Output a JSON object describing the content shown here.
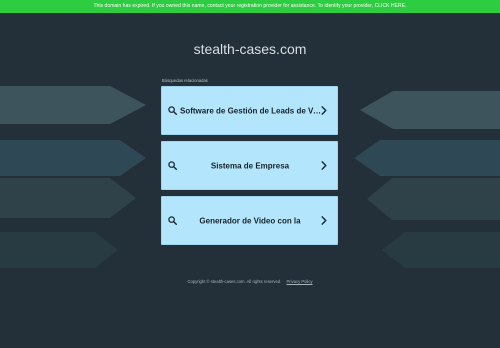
{
  "banner": {
    "text": "This domain has expired. If you owned this name, contact your registration provider for assistance. To identify your provider, CLICK HERE."
  },
  "site": {
    "domain": "stealth-cases.com"
  },
  "related": {
    "heading": "Búsquedas relacionadas",
    "items": [
      {
        "label": "Software de Gestión de Leads de Venta"
      },
      {
        "label": "Sistema de Empresa"
      },
      {
        "label": "Generador de Video con la"
      }
    ]
  },
  "footer": {
    "copyright": "Copyright © stealth-cases.com.  All rights reserved.",
    "privacy": "Privacy Policy"
  },
  "colors": {
    "background": "#233039",
    "banner": "#2ecc40",
    "card": "#b3e5fc",
    "arrow_light": "#3f5963",
    "arrow_mid": "#2f4650",
    "arrow_dark": "#2a3d46"
  },
  "icons": {
    "search": "search-icon",
    "chevron": "chevron-right-icon"
  }
}
